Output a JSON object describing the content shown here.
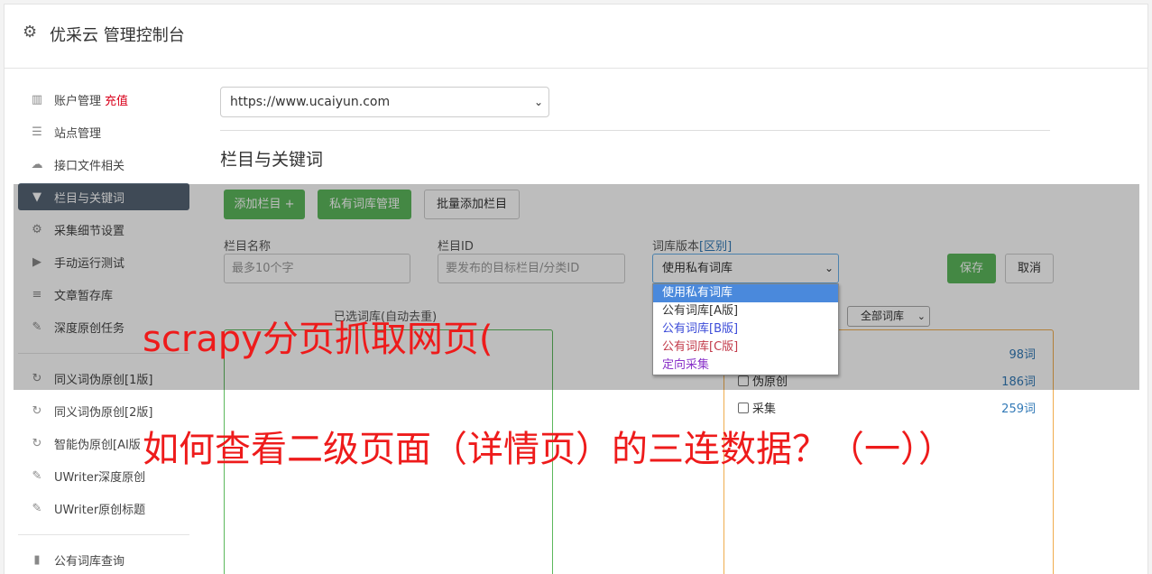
{
  "header": {
    "title": "优采云 管理控制台",
    "icon": "gear-icon"
  },
  "sidebar": {
    "items": [
      {
        "label": "账户管理",
        "extra": "充值",
        "icon": "bar-chart-icon"
      },
      {
        "label": "站点管理",
        "icon": "server-icon"
      },
      {
        "label": "接口文件相关",
        "icon": "cloud-upload-icon"
      },
      {
        "label": "栏目与关键词",
        "icon": "filter-icon",
        "active": true
      },
      {
        "label": "采集细节设置",
        "icon": "cogs-icon"
      },
      {
        "label": "手动运行测试",
        "icon": "play-icon"
      },
      {
        "label": "文章暂存库",
        "icon": "database-icon"
      },
      {
        "label": "深度原创任务",
        "icon": "edit-icon"
      },
      {
        "label": "同义词伪原创[1版]",
        "icon": "refresh-icon"
      },
      {
        "label": "同义词伪原创[2版]",
        "icon": "refresh-icon"
      },
      {
        "label": "智能伪原创[AI版",
        "icon": "refresh-icon"
      },
      {
        "label": "UWriter深度原创",
        "icon": "edit-icon"
      },
      {
        "label": "UWriter原创标题",
        "icon": "edit-icon"
      },
      {
        "label": "公有词库查询",
        "icon": "book-icon"
      }
    ]
  },
  "main": {
    "site_select": "https://www.ucaiyun.com",
    "section_title": "栏目与关键词",
    "buttons": {
      "add_column": "添加栏目 +",
      "private_lib": "私有词库管理",
      "batch_add": "批量添加栏目",
      "save": "保存",
      "cancel": "取消"
    },
    "fields": {
      "column_name_label": "栏目名称",
      "column_name_placeholder": "最多10个字",
      "column_id_label": "栏目ID",
      "column_id_placeholder": "要发布的目标栏目/分类ID",
      "lib_version_label": "词库版本",
      "lib_version_link": "[区别]",
      "lib_version_value": "使用私有词库"
    },
    "lib_version_options": [
      "使用私有词库",
      "公有词库[A版]",
      "公有词库[B版]",
      "公有词库[C版]",
      "定向采集"
    ],
    "selected_words_label": "已选词库(自动去重)",
    "all_lib_select": "全部词库",
    "lib_rows": [
      {
        "label": "",
        "count": "98词"
      },
      {
        "label": "伪原创",
        "count": "186词"
      },
      {
        "label": "采集",
        "count": "259词"
      }
    ]
  },
  "overlay_text": {
    "line1": "scrapy分页抓取网页(",
    "line2": "如何查看二级页面（详情页）的三连数据？（一））"
  }
}
